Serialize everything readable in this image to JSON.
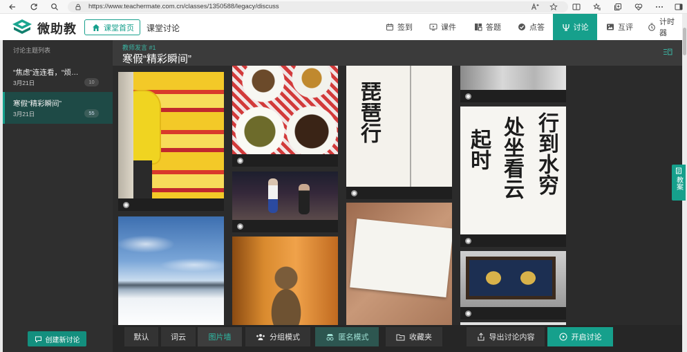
{
  "browser": {
    "url": "https://www.teachermate.com.cn/classes/1350588/legacy/discuss",
    "icons": [
      "back-icon",
      "refresh-icon",
      "search-icon",
      "lock-icon",
      "read-aloud-icon",
      "favorite-star-icon",
      "split-screen-icon",
      "favorites-icon",
      "collections-icon",
      "browser-essentials-icon",
      "more-icon",
      "sidebar-icon"
    ]
  },
  "app": {
    "logo_text": "微助教",
    "home_button": "课堂首页",
    "section_title": "课堂讨论",
    "nav": [
      {
        "label": "签到",
        "icon": "calendar-icon"
      },
      {
        "label": "课件",
        "icon": "courseware-icon"
      },
      {
        "label": "答题",
        "icon": "quiz-icon"
      },
      {
        "label": "点答",
        "icon": "check-circle-icon"
      },
      {
        "label": "讨论",
        "icon": "discussion-icon",
        "active": true
      },
      {
        "label": "互评",
        "icon": "peer-review-icon"
      },
      {
        "label": "计时器",
        "icon": "timer-icon"
      }
    ]
  },
  "sidebar": {
    "header": "讨论主题列表",
    "topics": [
      {
        "title": "“焦虑”连连看，“烦…",
        "date": "3月21日",
        "count": "10",
        "active": false
      },
      {
        "title": "寒假“精彩瞬间”",
        "date": "3月21日",
        "count": "55",
        "active": true
      }
    ],
    "create_button": "创建新讨论"
  },
  "discussion": {
    "tag": "教师发言 #1",
    "title": "寒假“精彩瞬间”"
  },
  "photo_wall": {
    "calligraphy_pipa": "琵琶行",
    "calligraphy_poem": [
      "行到水穷",
      "处坐看云",
      "起时"
    ]
  },
  "toolbar": {
    "views": [
      {
        "label": "默认",
        "active": false
      },
      {
        "label": "词云",
        "active": false
      },
      {
        "label": "图片墙",
        "active": true
      }
    ],
    "group_mode": "分组模式",
    "anonymous_mode": {
      "label": "匿名模式",
      "on": true
    },
    "favorites": "收藏夹",
    "export": "导出讨论内容",
    "start": "开启讨论"
  },
  "side_tab": {
    "label": "教案",
    "icon": "lesson-plan-icon"
  },
  "colors": {
    "accent": "#16a08c",
    "sidebar_active": "#1e4a46",
    "anonymous_bg": "#2d5650",
    "tag_text": "#3bb5a3"
  }
}
